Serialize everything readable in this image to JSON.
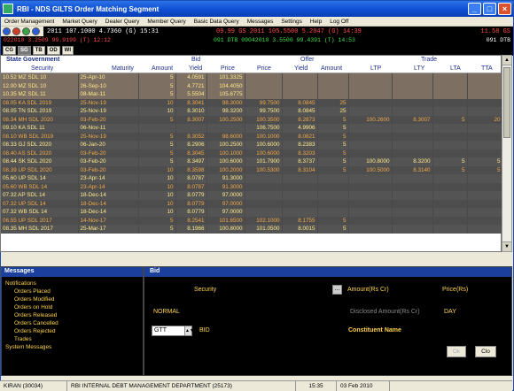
{
  "window": {
    "title": "RBI - NDS GILTS Order Matching Segment"
  },
  "menu": [
    "Order Management",
    "Market Query",
    "Dealer Query",
    "Member Query",
    "Basic Data Query",
    "Messages",
    "Settings",
    "Help",
    "Log Off"
  ],
  "ticker1": {
    "left": "2011 107.1000 4.7360 (G)  15:31",
    "right": "09.99 GS 2011 105.5500 5.2047 (G)   14:39",
    "far": "11.58 GS"
  },
  "ticker2": {
    "left": "022010 3.2509 99.9199 (T)   12:12",
    "right": "091 DTB 09042010 3.5500 99.4391 (T)   14:53",
    "far": "091 DTB"
  },
  "tabs": [
    "CG",
    "SG",
    "TB",
    "OD",
    "WI"
  ],
  "ticker3": "",
  "grid": {
    "group_header": "State Government",
    "groups": {
      "bid": "Bid",
      "offer": "Offer",
      "trade": "Trade"
    },
    "columns": [
      "Security",
      "Maturity",
      "Amount",
      "Yield",
      "Price",
      "Price",
      "Yield",
      "Amount",
      "LTP",
      "LTY",
      "LTA",
      "TTA"
    ],
    "rows": [
      [
        "10.52 MZ SDL 10",
        "25-Apr-10",
        "5",
        "4.0591",
        "101.3325",
        "",
        "",
        "",
        "",
        "",
        "",
        ""
      ],
      [
        "12.00 MZ SDL 10",
        "26-Sep-10",
        "5",
        "4.7721",
        "104.4050",
        "",
        "",
        "",
        "",
        "",
        "",
        ""
      ],
      [
        "10.35 MZ SDL 11",
        "08-Mar-11",
        "5",
        "5.5504",
        "105.6775",
        "",
        "",
        "",
        "",
        "",
        "",
        ""
      ],
      [
        "08.05 KA SDL 2019",
        "25-Nov-19",
        "10",
        "8.3041",
        "98.3000",
        "99.7500",
        "8.0845",
        "25",
        "",
        "",
        "",
        ""
      ],
      [
        "08.05 TN SDL 2019",
        "25-Nov-19",
        "10",
        "8.3010",
        "98.3200",
        "99.7500",
        "8.0845",
        "25",
        "",
        "",
        "",
        ""
      ],
      [
        "08.34 MH SDL 2020",
        "03-Feb-20",
        "5",
        "8.3007",
        "100.2500",
        "100.3500",
        "8.2873",
        "5",
        "100.2600",
        "8.3007",
        "5",
        "20"
      ],
      [
        "09.10 KA SDL 11",
        "06-Nov-11",
        "",
        "",
        "",
        "106.7500",
        "4.9906",
        "5",
        "",
        "",
        "",
        ""
      ],
      [
        "08.10 WB SDL 2019",
        "25-Nov-19",
        "5",
        "8.3052",
        "98.6000",
        "100.1000",
        "8.0821",
        "5",
        "",
        "",
        "",
        ""
      ],
      [
        "08.33 GJ SDL 2020",
        "06-Jan-20",
        "5",
        "8.2906",
        "100.2500",
        "100.6000",
        "8.2383",
        "5",
        "",
        "",
        "",
        ""
      ],
      [
        "08.40 AS SDL 2020",
        "03-Feb-20",
        "5",
        "8.3045",
        "100.1000",
        "100.6000",
        "8.3203",
        "5",
        "",
        "",
        "",
        ""
      ],
      [
        "08.44 SK SDL 2020",
        "03-Feb-20",
        "5",
        "8.3497",
        "100.6000",
        "101.7900",
        "8.3737",
        "5",
        "100.8000",
        "8.3200",
        "5",
        "5"
      ],
      [
        "08.39 UP SDL 2020",
        "03-Feb-20",
        "10",
        "8.3598",
        "100.2000",
        "100.5300",
        "8.3104",
        "5",
        "100.5000",
        "8.3140",
        "5",
        "5"
      ],
      [
        "05.60 UP SDL 14",
        "23-Apr-14",
        "10",
        "8.0787",
        "91.3000",
        "",
        "",
        "",
        "",
        "",
        "",
        ""
      ],
      [
        "05.60 WB SDL 14",
        "23-Apr-14",
        "10",
        "8.0787",
        "91.3000",
        "",
        "",
        "",
        "",
        "",
        "",
        ""
      ],
      [
        "07.32 AP SDL 14",
        "18-Dec-14",
        "10",
        "8.0779",
        "97.0000",
        "",
        "",
        "",
        "",
        "",
        "",
        ""
      ],
      [
        "07.32 UP SDL 14",
        "18-Dec-14",
        "10",
        "8.0779",
        "97.0000",
        "",
        "",
        "",
        "",
        "",
        "",
        ""
      ],
      [
        "07.32 WB SDL 14",
        "18-Dec-14",
        "10",
        "8.0779",
        "97.0000",
        "",
        "",
        "",
        "",
        "",
        "",
        ""
      ],
      [
        "06.55 UP SDL 2017",
        "14-Nov-17",
        "5",
        "8.2541",
        "101.6500",
        "102.1000",
        "8.1755",
        "5",
        "",
        "",
        "",
        ""
      ],
      [
        "08.35 MH SDL 2017",
        "25-Mar-17",
        "5",
        "8.1966",
        "100.8000",
        "101.0500",
        "8.0015",
        "5",
        "",
        "",
        "",
        ""
      ]
    ]
  },
  "messages": {
    "title": "Messages",
    "tree": [
      {
        "label": "Notifications",
        "level": 0
      },
      {
        "label": "Orders Placed",
        "level": 1
      },
      {
        "label": "Orders Modified",
        "level": 1
      },
      {
        "label": "Orders on Hold",
        "level": 1
      },
      {
        "label": "Orders Released",
        "level": 1
      },
      {
        "label": "Orders Cancelled",
        "level": 1
      },
      {
        "label": "Orders Rejected",
        "level": 1
      },
      {
        "label": "Trades",
        "level": 1
      },
      {
        "label": "System Messages",
        "level": 0
      }
    ]
  },
  "bid": {
    "title": "Bid",
    "security_label": "Security",
    "amount_label": "Amount(Rs Cr)",
    "price_label": "Price(Rs)",
    "normal_label": "NORMAL",
    "disclosed_label": "Disclosed Amount(Rs Cr)",
    "day_label": "DAY",
    "gtt_value": "GTT",
    "bid_label": "BID",
    "constituent_label": "Constituent Name",
    "ok_label": "Ok",
    "close_label": "Clo"
  },
  "status": {
    "user": "KIRAN (30034)",
    "dept": "RBI INTERNAL DEBT MANAGEMENT DEPARTMENT (25173)",
    "time": "15:35",
    "date": "03 Feb 2010"
  }
}
